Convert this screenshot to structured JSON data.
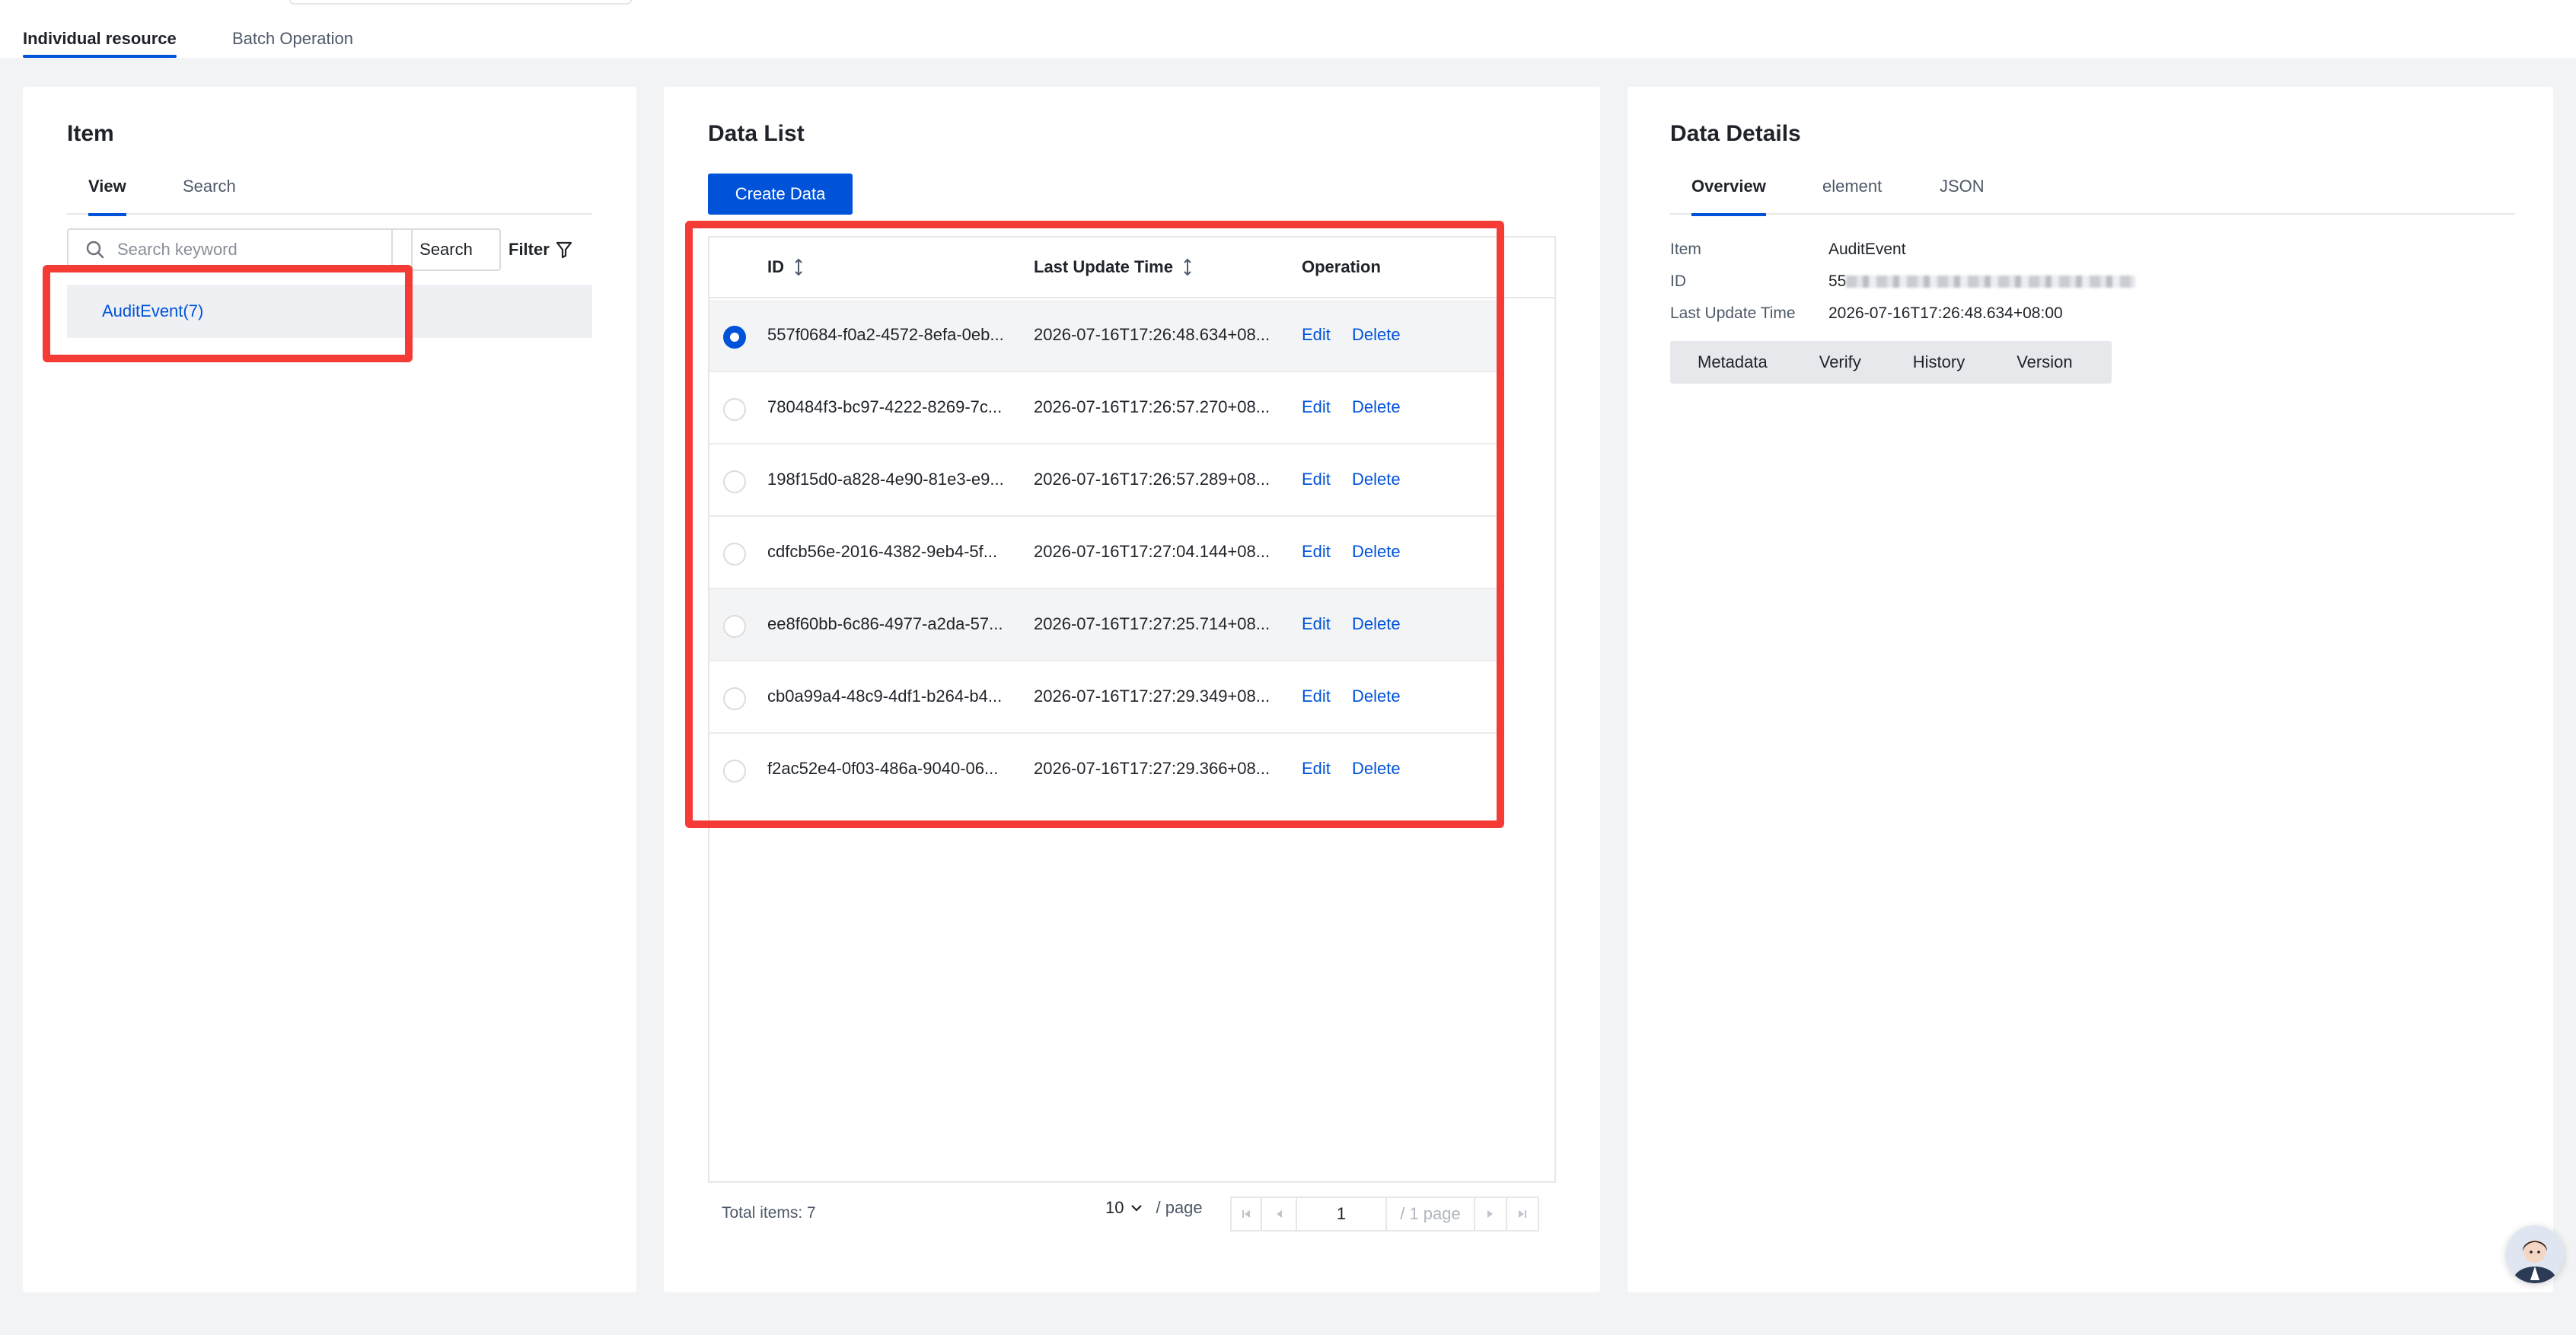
{
  "top_tabs": [
    {
      "label": "Individual resource",
      "active": true
    },
    {
      "label": "Batch Operation",
      "active": false
    }
  ],
  "item_panel": {
    "title": "Item",
    "tabs": [
      {
        "label": "View",
        "active": true
      },
      {
        "label": "Search",
        "active": false
      }
    ],
    "search_placeholder": "Search keyword",
    "search_button": "Search",
    "filter_label": "Filter",
    "items": [
      {
        "label": "AuditEvent(7)",
        "selected": true
      }
    ]
  },
  "data_list": {
    "title": "Data List",
    "create_button": "Create Data",
    "columns": [
      "ID",
      "Last Update Time",
      "Operation"
    ],
    "rows": [
      {
        "id": "557f0684-f0a2-4572-8efa-0eb...",
        "time": "2026-07-16T17:26:48.634+08...",
        "edit": "Edit",
        "delete": "Delete",
        "selected": true
      },
      {
        "id": "780484f3-bc97-4222-8269-7c...",
        "time": "2026-07-16T17:26:57.270+08...",
        "edit": "Edit",
        "delete": "Delete",
        "selected": false
      },
      {
        "id": "198f15d0-a828-4e90-81e3-e9...",
        "time": "2026-07-16T17:26:57.289+08...",
        "edit": "Edit",
        "delete": "Delete",
        "selected": false
      },
      {
        "id": "cdfcb56e-2016-4382-9eb4-5f...",
        "time": "2026-07-16T17:27:04.144+08...",
        "edit": "Edit",
        "delete": "Delete",
        "selected": false
      },
      {
        "id": "ee8f60bb-6c86-4977-a2da-57...",
        "time": "2026-07-16T17:27:25.714+08...",
        "edit": "Edit",
        "delete": "Delete",
        "selected": false
      },
      {
        "id": "cb0a99a4-48c9-4df1-b264-b4...",
        "time": "2026-07-16T17:27:29.349+08...",
        "edit": "Edit",
        "delete": "Delete",
        "selected": false
      },
      {
        "id": "f2ac52e4-0f03-486a-9040-06...",
        "time": "2026-07-16T17:27:29.366+08...",
        "edit": "Edit",
        "delete": "Delete",
        "selected": false
      }
    ],
    "footer": {
      "total": "Total items: 7",
      "page_size": "10",
      "page_size_unit": "/ page",
      "current_page": "1",
      "page_total": "/ 1 page"
    }
  },
  "details": {
    "title": "Data Details",
    "tabs": [
      {
        "label": "Overview",
        "active": true
      },
      {
        "label": "element",
        "active": false
      },
      {
        "label": "JSON",
        "active": false
      }
    ],
    "fields": {
      "item_label": "Item",
      "item_value": "AuditEvent",
      "id_label": "ID",
      "id_value_prefix": "55",
      "time_label": "Last Update Time",
      "time_value": "2026-07-16T17:26:48.634+08:00"
    },
    "segments": [
      "Metadata",
      "Verify",
      "History",
      "Version"
    ]
  },
  "colors": {
    "accent": "#0052d9",
    "highlight": "#f53b35"
  },
  "icons": [
    "search-icon",
    "filter-icon",
    "sort-icon",
    "chevron-down-icon",
    "first-page-icon",
    "prev-page-icon",
    "next-page-icon",
    "last-page-icon",
    "avatar"
  ]
}
